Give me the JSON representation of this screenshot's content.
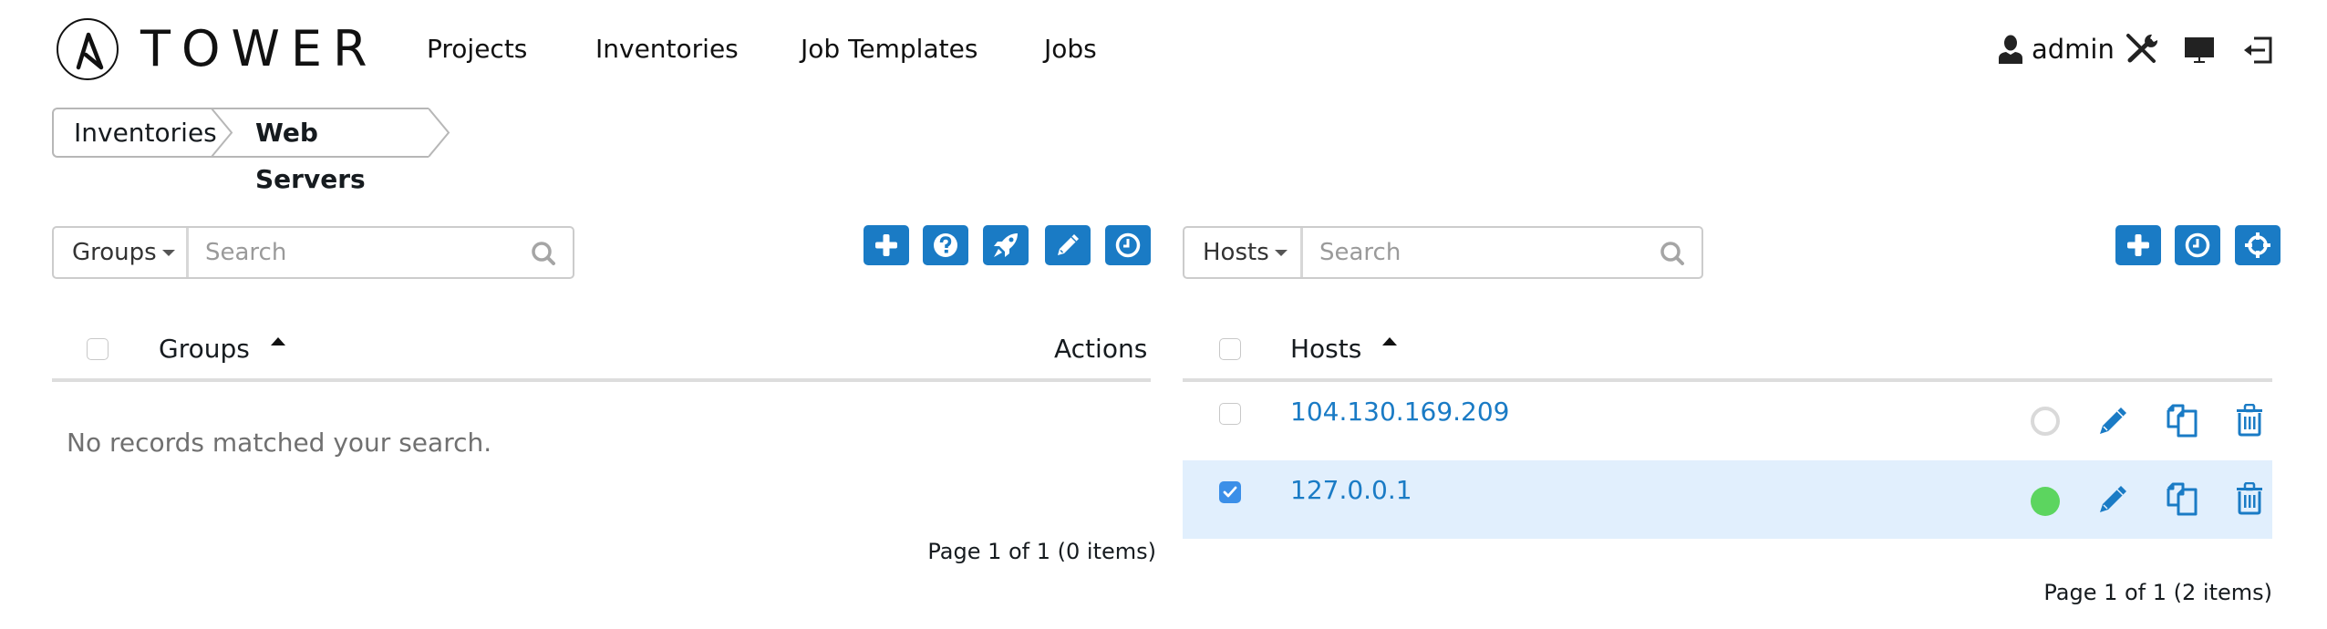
{
  "app": {
    "brand": "TOWER"
  },
  "nav": {
    "items": [
      {
        "label": "Projects"
      },
      {
        "label": "Inventories"
      },
      {
        "label": "Job Templates"
      },
      {
        "label": "Jobs"
      }
    ],
    "user": "admin",
    "icons": [
      "user-icon",
      "wrench-screwdriver-icon",
      "monitor-icon",
      "logout-icon"
    ]
  },
  "breadcrumb": {
    "items": [
      {
        "label": "Inventories"
      },
      {
        "label": "Web Servers"
      }
    ]
  },
  "groups_panel": {
    "search": {
      "dropdown_value": "Groups",
      "placeholder": "Search",
      "value": ""
    },
    "toolbar": [
      "add-icon",
      "help-icon",
      "rocket-icon",
      "edit-icon",
      "schedule-icon"
    ],
    "columns": {
      "name": "Groups",
      "actions": "Actions"
    },
    "sort": "ascending",
    "empty_message": "No records matched your search.",
    "pagination": "Page 1 of 1 (0 items)"
  },
  "hosts_panel": {
    "search": {
      "dropdown_value": "Hosts",
      "placeholder": "Search",
      "value": ""
    },
    "toolbar": [
      "add-icon",
      "schedule-icon",
      "crosshairs-icon"
    ],
    "columns": {
      "name": "Hosts"
    },
    "sort": "ascending",
    "rows": [
      {
        "name": "104.130.169.209",
        "selected": false,
        "status": "inactive"
      },
      {
        "name": "127.0.0.1",
        "selected": true,
        "status": "active"
      }
    ],
    "pagination": "Page 1 of 1 (2 items)"
  },
  "colors": {
    "accent": "#1a7bc5",
    "selected_row": "#e1effd",
    "status_active": "#5cd55f",
    "status_inactive": "#d9d9d9"
  }
}
